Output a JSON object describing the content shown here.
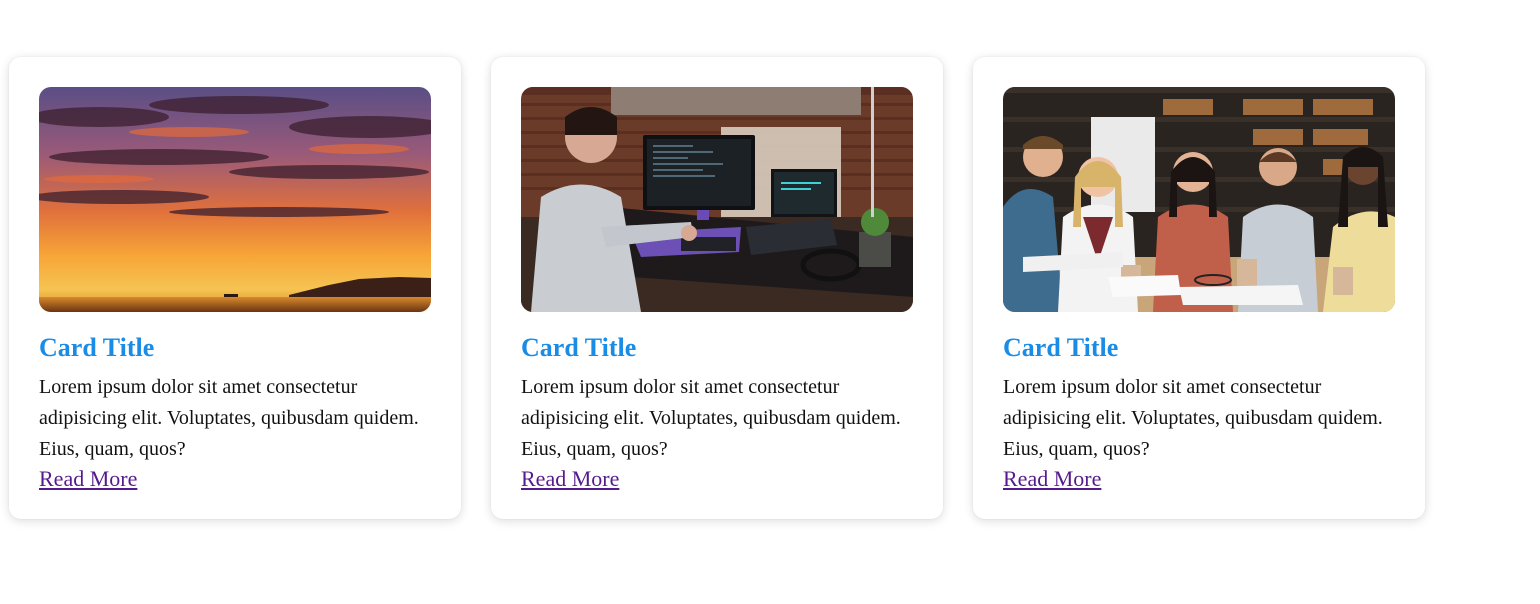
{
  "cards": [
    {
      "image_subject": "sunset-over-sea",
      "title": "Card Title",
      "text": "Lorem ipsum dolor sit amet consectetur adipisicing elit. Voluptates, quibusdam quidem. Eius, quam, quos?",
      "link_label": "Read More"
    },
    {
      "image_subject": "developer-at-computer-desk",
      "title": "Card Title",
      "text": "Lorem ipsum dolor sit amet consectetur adipisicing elit. Voluptates, quibusdam quidem. Eius, quam, quos?",
      "link_label": "Read More"
    },
    {
      "image_subject": "students-studying-in-library",
      "title": "Card Title",
      "text": "Lorem ipsum dolor sit amet consectetur adipisicing elit. Voluptates, quibusdam quidem. Eius, quam, quos?",
      "link_label": "Read More"
    }
  ],
  "colors": {
    "title": "#1a8ce6",
    "link_visited": "#551a8b",
    "text": "#111111",
    "card_background": "#ffffff"
  }
}
